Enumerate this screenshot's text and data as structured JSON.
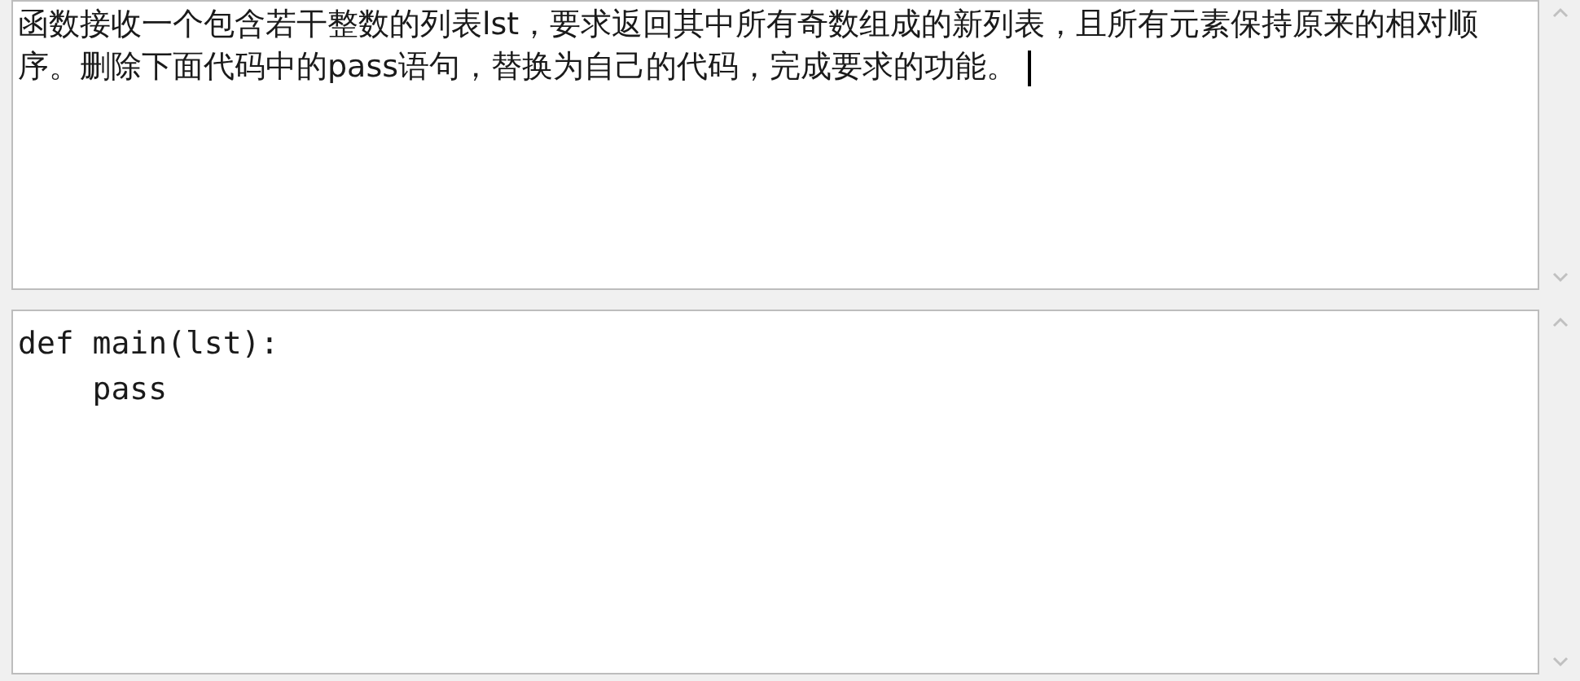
{
  "question": {
    "text": "函数接收一个包含若干整数的列表lst，要求返回其中所有奇数组成的新列表，且所有元素保持原来的相对顺序。删除下面代码中的pass语句，替换为自己的代码，完成要求的功能。"
  },
  "code_editor": {
    "value": "def main(lst):\n    pass"
  }
}
